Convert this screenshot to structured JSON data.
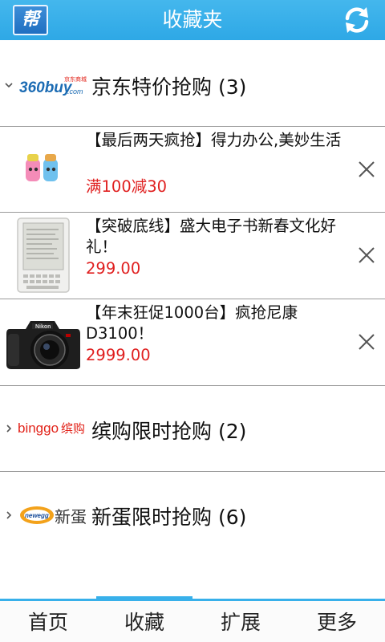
{
  "header": {
    "logo_text": "帮",
    "title": "收藏夹",
    "refresh_icon": "refresh-icon"
  },
  "groups": [
    {
      "logo_text": "360buy",
      "logo_sub": "京东商城",
      "logo_domain": ".com",
      "title": "京东特价抢购 (3)",
      "expanded": true,
      "items": [
        {
          "title": "【最后两天疯抢】得力办公,美妙生活",
          "price": "满100减30",
          "thumb_icon": "toy-bottles-image"
        },
        {
          "title": "【突破底线】盛大电子书新春文化好礼！",
          "price": "299.00",
          "thumb_icon": "ebook-reader-image"
        },
        {
          "title": "【年末狂促1000台】疯抢尼康D3100！",
          "price": "2999.00",
          "thumb_icon": "nikon-camera-image"
        }
      ]
    },
    {
      "logo_text": "binggo",
      "logo_sub": "缤购",
      "title": "缤购限时抢购 (2)",
      "expanded": false
    },
    {
      "logo_text": "newegg",
      "logo_sub": "新蛋",
      "title": "新蛋限时抢购 (6)",
      "expanded": false
    }
  ],
  "camera_brand": "Nikon",
  "tabs": [
    {
      "label": "首页"
    },
    {
      "label": "收藏"
    },
    {
      "label": "扩展"
    },
    {
      "label": "更多"
    }
  ],
  "active_tab": "收藏",
  "colors": {
    "accent": "#38b0ea",
    "price": "#e02020",
    "header": "#2ea8e6"
  }
}
